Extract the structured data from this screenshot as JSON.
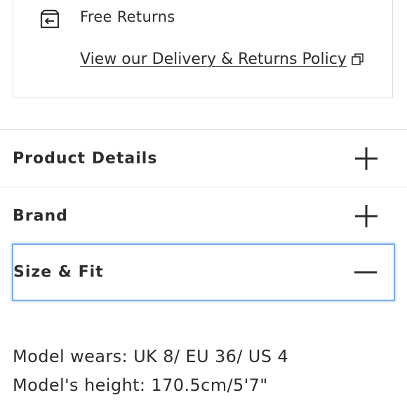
{
  "delivery": {
    "returns_label": "Free Returns",
    "policy_link": "View our Delivery & Returns Policy",
    "returns_icon": "returns-box-icon",
    "external_icon": "external-link-icon"
  },
  "accordion": [
    {
      "label": "Product Details",
      "state": "collapsed",
      "toggle_icon": "plus-icon"
    },
    {
      "label": "Brand",
      "state": "collapsed",
      "toggle_icon": "plus-icon"
    },
    {
      "label": "Size & Fit",
      "state": "expanded",
      "toggle_icon": "minus-icon"
    }
  ],
  "size_fit": {
    "model_wears": "Model wears: UK 8/ EU 36/ US 4",
    "model_height": "Model's height: 170.5cm/5'7\""
  },
  "colors": {
    "text": "#2d2d2d",
    "border": "#e2e2e2",
    "focus": "#7aaee8"
  }
}
